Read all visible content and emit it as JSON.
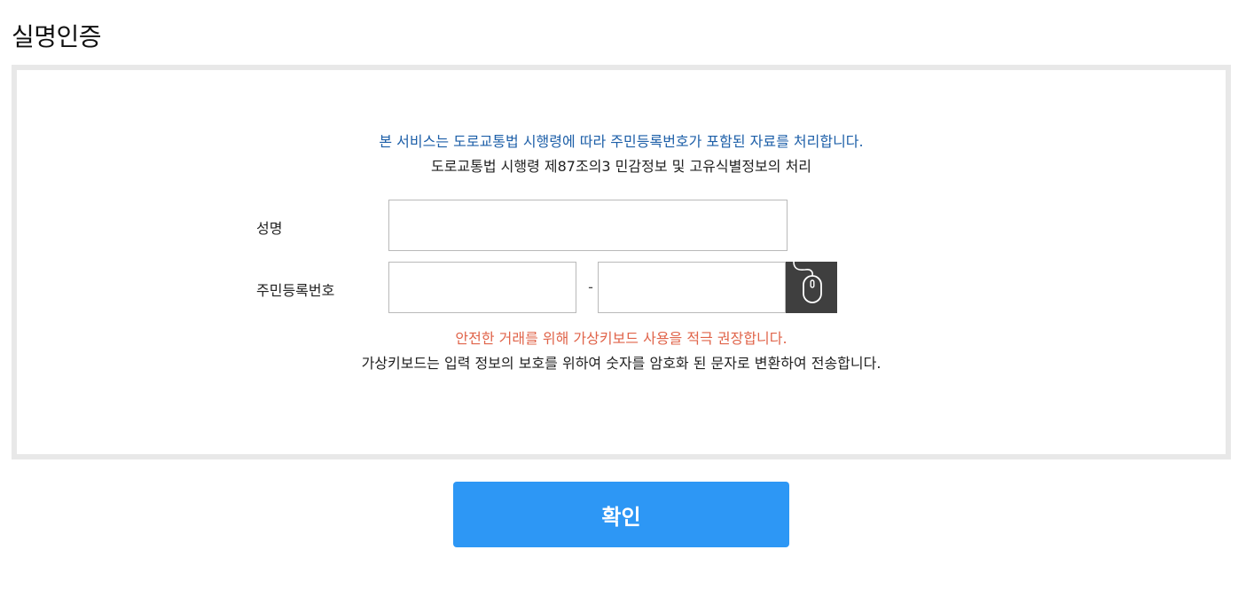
{
  "page": {
    "title": "실명인증"
  },
  "notice": {
    "service_line": "본 서비스는 도로교통법 시행령에 따라 주민등록번호가 포함된 자료를 처리합니다.",
    "law_line": "도로교통법 시행령 제87조의3 민감정보 및 고유식별정보의 처리"
  },
  "form": {
    "name_label": "성명",
    "name_value": "",
    "rrn_label": "주민등록번호",
    "rrn_front_value": "",
    "rrn_separator": "-",
    "rrn_back_value": "",
    "keypad_icon": "mouse-icon"
  },
  "keypad_notice": {
    "warning": "안전한 거래를 위해 가상키보드 사용을 적극 권장합니다.",
    "description": "가상키보드는 입력 정보의 보호를 위하여 숫자를 암호화 된 문자로 변환하여 전송합니다."
  },
  "actions": {
    "confirm_label": "확인"
  },
  "colors": {
    "notice_blue": "#1d5fa8",
    "warning_red": "#e0644a",
    "confirm_button": "#2d97f5",
    "keypad_button": "#3f3f3f",
    "panel_border": "#e8e8e8"
  }
}
